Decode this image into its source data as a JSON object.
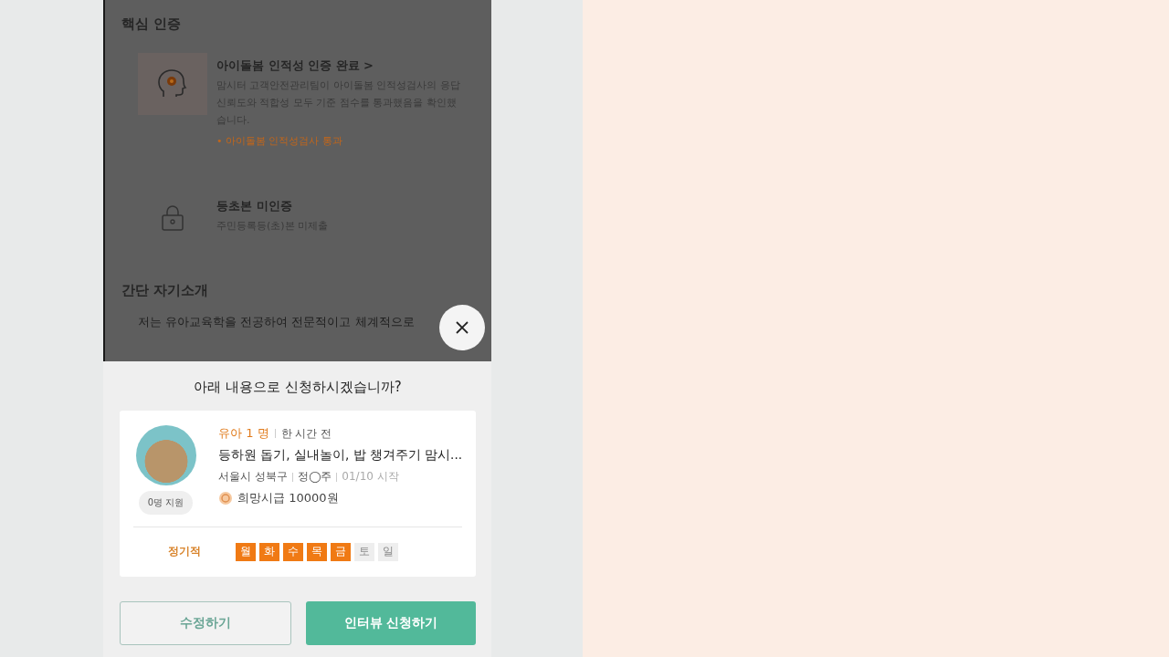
{
  "background": {
    "cert_section": {
      "title": "핵심 인증",
      "items": [
        {
          "kind": "brain",
          "title": "아이돌봄 인적성 인증 완료 >",
          "description": "맘시터 고객안전관리팀이 아이돌봄 인적성검사의 응답신뢰도와 적합성 모두 기준 점수를 통과했음을 확인했습니다.",
          "bullet": "• 아이돌봄 인적성검사 통과"
        },
        {
          "kind": "lock",
          "title": "등초본 미인증",
          "description": "주민등록등(초)본 미제출"
        }
      ]
    },
    "intro_section": {
      "title": "간단 자기소개",
      "text": "저는 유아교육학을 전공하여 전문적이고 체계적으로"
    }
  },
  "modal": {
    "question": "아래 내용으로 신청하시겠습니까?",
    "card": {
      "applicants": "0명 지원",
      "children": "유아 1 명",
      "posted": "한 시간 전",
      "summary": "등하원 돕기, 실내놀이, 밥 챙겨주기 맘시...",
      "location": "서울시 성북구",
      "name": "정◯주",
      "start": "01/10 시작",
      "wage": "희망시급 10000원",
      "schedule_type": "정기적",
      "days": [
        {
          "label": "월",
          "selected": true
        },
        {
          "label": "화",
          "selected": true
        },
        {
          "label": "수",
          "selected": true
        },
        {
          "label": "목",
          "selected": true
        },
        {
          "label": "금",
          "selected": true
        },
        {
          "label": "토",
          "selected": false
        },
        {
          "label": "일",
          "selected": false
        }
      ]
    },
    "buttons": [
      {
        "kind": "secondary",
        "label": "수정하기"
      },
      {
        "kind": "primary",
        "label": "인터뷰 신청하기"
      }
    ]
  }
}
